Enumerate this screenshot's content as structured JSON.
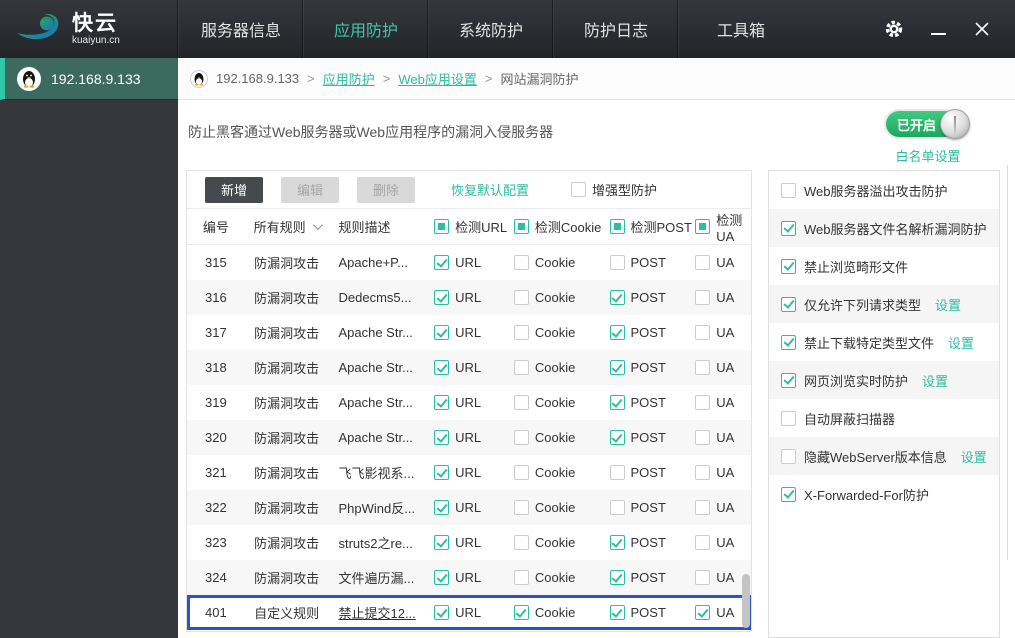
{
  "brand": {
    "name": "快云",
    "domain": "kuaiyun.cn"
  },
  "nav": {
    "items": [
      {
        "label": "服务器信息",
        "active": false
      },
      {
        "label": "应用防护",
        "active": true
      },
      {
        "label": "系统防护",
        "active": false
      },
      {
        "label": "防护日志",
        "active": false
      },
      {
        "label": "工具箱",
        "active": false
      }
    ]
  },
  "sidebar": {
    "server": "192.168.9.133"
  },
  "breadcrumb": {
    "server": "192.168.9.133",
    "links": [
      "应用防护",
      "Web应用设置"
    ],
    "current": "网站漏洞防护",
    "separator": ">"
  },
  "main": {
    "description": "防止黑客通过Web服务器或Web应用程序的漏洞入侵服务器",
    "toggle_label": "已开启",
    "whitelist_link": "白名单设置",
    "toolbar": {
      "add": "新增",
      "edit": "编辑",
      "delete": "删除",
      "restore": "恢复默认配置",
      "enhanced": "增强型防护",
      "enhanced_checked": false
    },
    "table": {
      "headers": {
        "id": "编号",
        "rule": "所有规则",
        "desc": "规则描述",
        "url": "检测URL",
        "cookie": "检测Cookie",
        "post": "检测POST",
        "ua": "检测UA"
      },
      "check_labels": {
        "url": "URL",
        "cookie": "Cookie",
        "post": "POST",
        "ua": "UA"
      },
      "rows": [
        {
          "id": "315",
          "type": "防漏洞攻击",
          "desc": "Apache+P...",
          "url": true,
          "cookie": false,
          "post": false,
          "ua": false,
          "highlighted": false
        },
        {
          "id": "316",
          "type": "防漏洞攻击",
          "desc": "Dedecms5...",
          "url": true,
          "cookie": false,
          "post": true,
          "ua": false,
          "highlighted": false
        },
        {
          "id": "317",
          "type": "防漏洞攻击",
          "desc": "Apache Str...",
          "url": true,
          "cookie": false,
          "post": true,
          "ua": false,
          "highlighted": false
        },
        {
          "id": "318",
          "type": "防漏洞攻击",
          "desc": "Apache Str...",
          "url": true,
          "cookie": false,
          "post": true,
          "ua": false,
          "highlighted": false
        },
        {
          "id": "319",
          "type": "防漏洞攻击",
          "desc": "Apache Str...",
          "url": true,
          "cookie": false,
          "post": true,
          "ua": false,
          "highlighted": false
        },
        {
          "id": "320",
          "type": "防漏洞攻击",
          "desc": "Apache Str...",
          "url": true,
          "cookie": false,
          "post": true,
          "ua": false,
          "highlighted": false
        },
        {
          "id": "321",
          "type": "防漏洞攻击",
          "desc": "飞飞影视系...",
          "url": true,
          "cookie": false,
          "post": false,
          "ua": false,
          "highlighted": false
        },
        {
          "id": "322",
          "type": "防漏洞攻击",
          "desc": "PhpWind反...",
          "url": true,
          "cookie": false,
          "post": false,
          "ua": false,
          "highlighted": false
        },
        {
          "id": "323",
          "type": "防漏洞攻击",
          "desc": "struts2之re...",
          "url": true,
          "cookie": false,
          "post": true,
          "ua": false,
          "highlighted": false
        },
        {
          "id": "324",
          "type": "防漏洞攻击",
          "desc": "文件遍历漏...",
          "url": true,
          "cookie": false,
          "post": true,
          "ua": false,
          "highlighted": false
        },
        {
          "id": "401",
          "type": "自定义规则",
          "desc": "禁止提交12...",
          "url": true,
          "cookie": true,
          "post": true,
          "ua": true,
          "highlighted": true
        }
      ]
    }
  },
  "right_panel": {
    "settings_label": "设置",
    "items": [
      {
        "label": "Web服务器溢出攻击防护",
        "checked": false,
        "settings": false
      },
      {
        "label": "Web服务器文件名解析漏洞防护",
        "checked": true,
        "settings": false
      },
      {
        "label": "禁止浏览畸形文件",
        "checked": true,
        "settings": false
      },
      {
        "label": "仅允许下列请求类型",
        "checked": true,
        "settings": true
      },
      {
        "label": "禁止下载特定类型文件",
        "checked": true,
        "settings": true
      },
      {
        "label": "网页浏览实时防护",
        "checked": true,
        "settings": true
      },
      {
        "label": "自动屏蔽扫描器",
        "checked": false,
        "settings": false
      },
      {
        "label": "隐藏WebServer版本信息",
        "checked": false,
        "settings": true
      },
      {
        "label": "X-Forwarded-For防护",
        "checked": true,
        "settings": false
      }
    ]
  },
  "colors": {
    "accent_teal": "#2cbda0",
    "nav_active": "#3fc8aa",
    "toggle_green": "#2eb872",
    "highlight_blue": "#2b52c8",
    "titlebar_dark": "#2a2c30",
    "sidebar_dark": "#34373c",
    "sidebar_selected": "#3c6a5f"
  }
}
